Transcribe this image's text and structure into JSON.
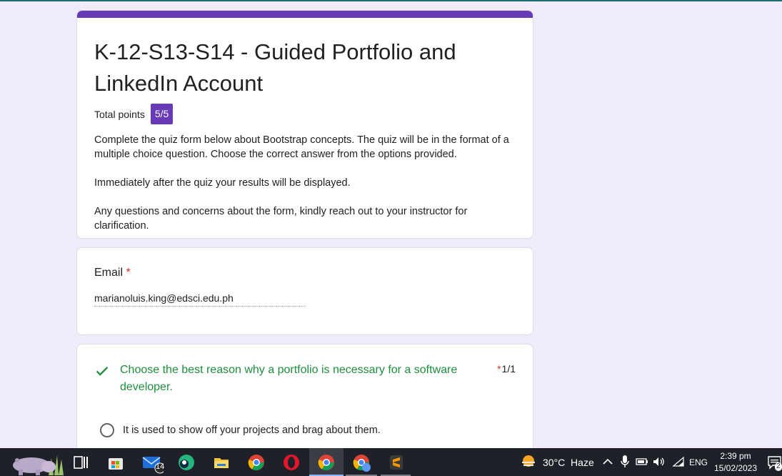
{
  "form": {
    "title": "K-12-S13-S14 - Guided Portfolio and LinkedIn Account",
    "points_label": "Total points",
    "points_value": "5/5",
    "description": [
      "Complete the quiz form below about Bootstrap concepts. The quiz will be in the format of a multiple choice question. Choose the correct answer from the options provided.",
      "Immediately after the quiz your results will be displayed.",
      "Any questions and concerns about the form, kindly reach out to your instructor for clarification."
    ]
  },
  "email": {
    "label": "Email",
    "required_mark": "*",
    "value": "marianoluis.king@edsci.edu.ph"
  },
  "question1": {
    "text": "Choose the best reason why a portfolio is necessary for a software developer.",
    "required_mark": "*",
    "score": "1/1",
    "option1": "It is used to show off your projects and brag about them."
  },
  "taskbar": {
    "badge_count": "14",
    "weather": "30°C  Haze",
    "language": "ENG",
    "time": "2:39 pm",
    "date": "15/02/2023",
    "notification_count": "2"
  },
  "colors": {
    "accent": "#673ab7",
    "correct": "#1e8e3e",
    "background": "#f0ebf8"
  }
}
